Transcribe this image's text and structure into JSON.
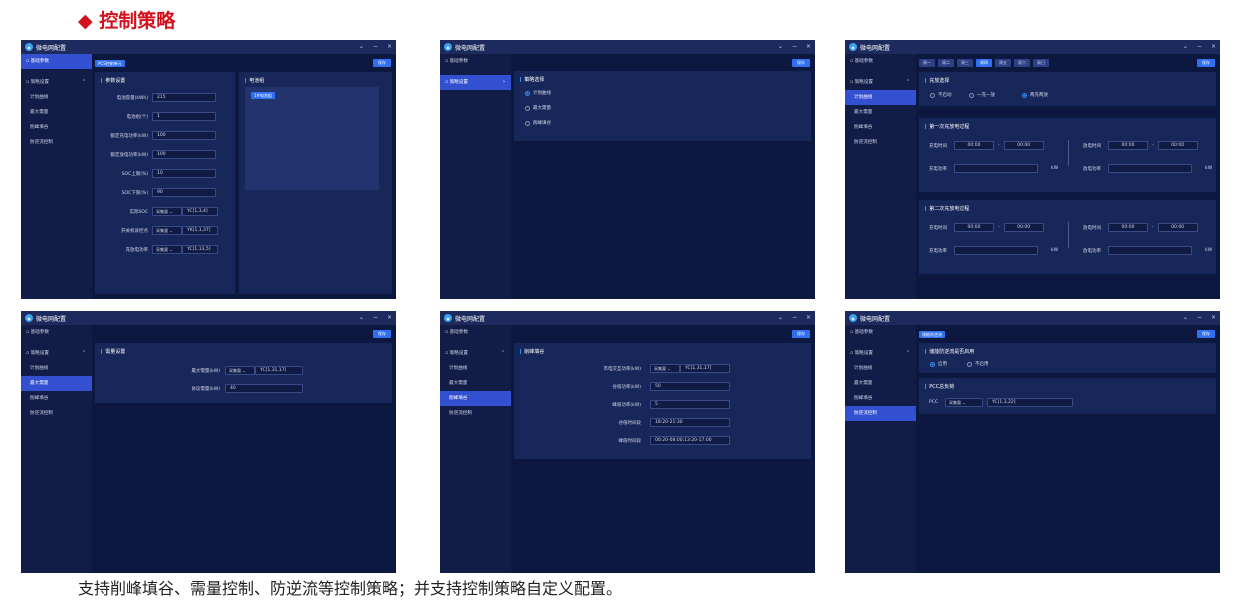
{
  "heading": "◆ 控制策略",
  "caption": "支持削峰填谷、需量控制、防逆流等控制策略；并支持控制策略自定义配置。",
  "window": {
    "title": "微电网配置",
    "logo": "logo-icon",
    "controls": [
      "⌄",
      "−",
      "×"
    ]
  },
  "sidebar": {
    "basic": "基础参数",
    "strategy": "策略设置",
    "items": [
      "计划曲线",
      "最大需量",
      "削峰填谷",
      "防逆流控制"
    ]
  },
  "save": "保存",
  "params": {
    "badge": "PCS控制单元",
    "title": "参数设置",
    "battery_title": "电池组",
    "battery_badge": "1#电池组",
    "fields": [
      {
        "label": "电池容量(kWh)",
        "value": "215"
      },
      {
        "label": "电池组(个)",
        "value": "1"
      },
      {
        "label": "额定充电功率(kW)",
        "value": "100"
      },
      {
        "label": "额定放电功率(kW)",
        "value": "100"
      },
      {
        "label": "SOC上限(%)",
        "value": "10"
      },
      {
        "label": "SOC下限(%)",
        "value": "90"
      }
    ],
    "selects": [
      {
        "label": "实际SOC",
        "sel": "采集量",
        "value": "YC[1,3,4]"
      },
      {
        "label": "开关机诉控点",
        "sel": "采集量",
        "value": "YK[1,1,37]"
      },
      {
        "label": "充放电功率",
        "sel": "采集量",
        "value": "YC[1,13,5]"
      }
    ]
  },
  "strategy": {
    "title": "策略选择",
    "options": [
      "计划曲线",
      "最大需量",
      "削峰填谷"
    ]
  },
  "plan": {
    "tabs": [
      "周一",
      "周二",
      "周三",
      "周四",
      "周五",
      "周六",
      "周日"
    ],
    "mode_title": "充放选择",
    "modes": [
      "不启动",
      "一充一放",
      "两充两放"
    ],
    "first_title": "第一次充放电过程",
    "second_title": "第二次充放电过程",
    "charge_time": "充电时间",
    "discharge_time": "放电时间",
    "charge_power": "充电功率",
    "discharge_power": "放电功率",
    "time_default": "00:00",
    "unit": "kW"
  },
  "demand": {
    "title": "需量设置",
    "fields": [
      {
        "label": "最大需量(kW)",
        "sel": "采集量",
        "value": "YC[1,31,17]"
      },
      {
        "label": "协议需量(kW)",
        "value": "40"
      }
    ]
  },
  "peak": {
    "title": "削峰填谷",
    "fields": [
      {
        "label": "市电交互功率(kW)",
        "sel": "采集量",
        "value": "YC[1,31,17]"
      },
      {
        "label": "谷值功率(kW)",
        "value": "50"
      },
      {
        "label": "峰值功率(kW)",
        "value": "5"
      },
      {
        "label": "谷值时间段",
        "value": "18:20-21:30"
      },
      {
        "label": "峰值时间段",
        "value": "00:20-08:00;13:20-17:00"
      }
    ]
  },
  "anti": {
    "badge": "储能防逆流",
    "enable_title": "储能防逆流是否启用",
    "options": [
      "启用",
      "不启用"
    ],
    "pcc_title": "PCC总负荷",
    "pcc_label": "PCC",
    "pcc_sel": "采集量",
    "pcc_value": "YC[1,3,22]"
  }
}
